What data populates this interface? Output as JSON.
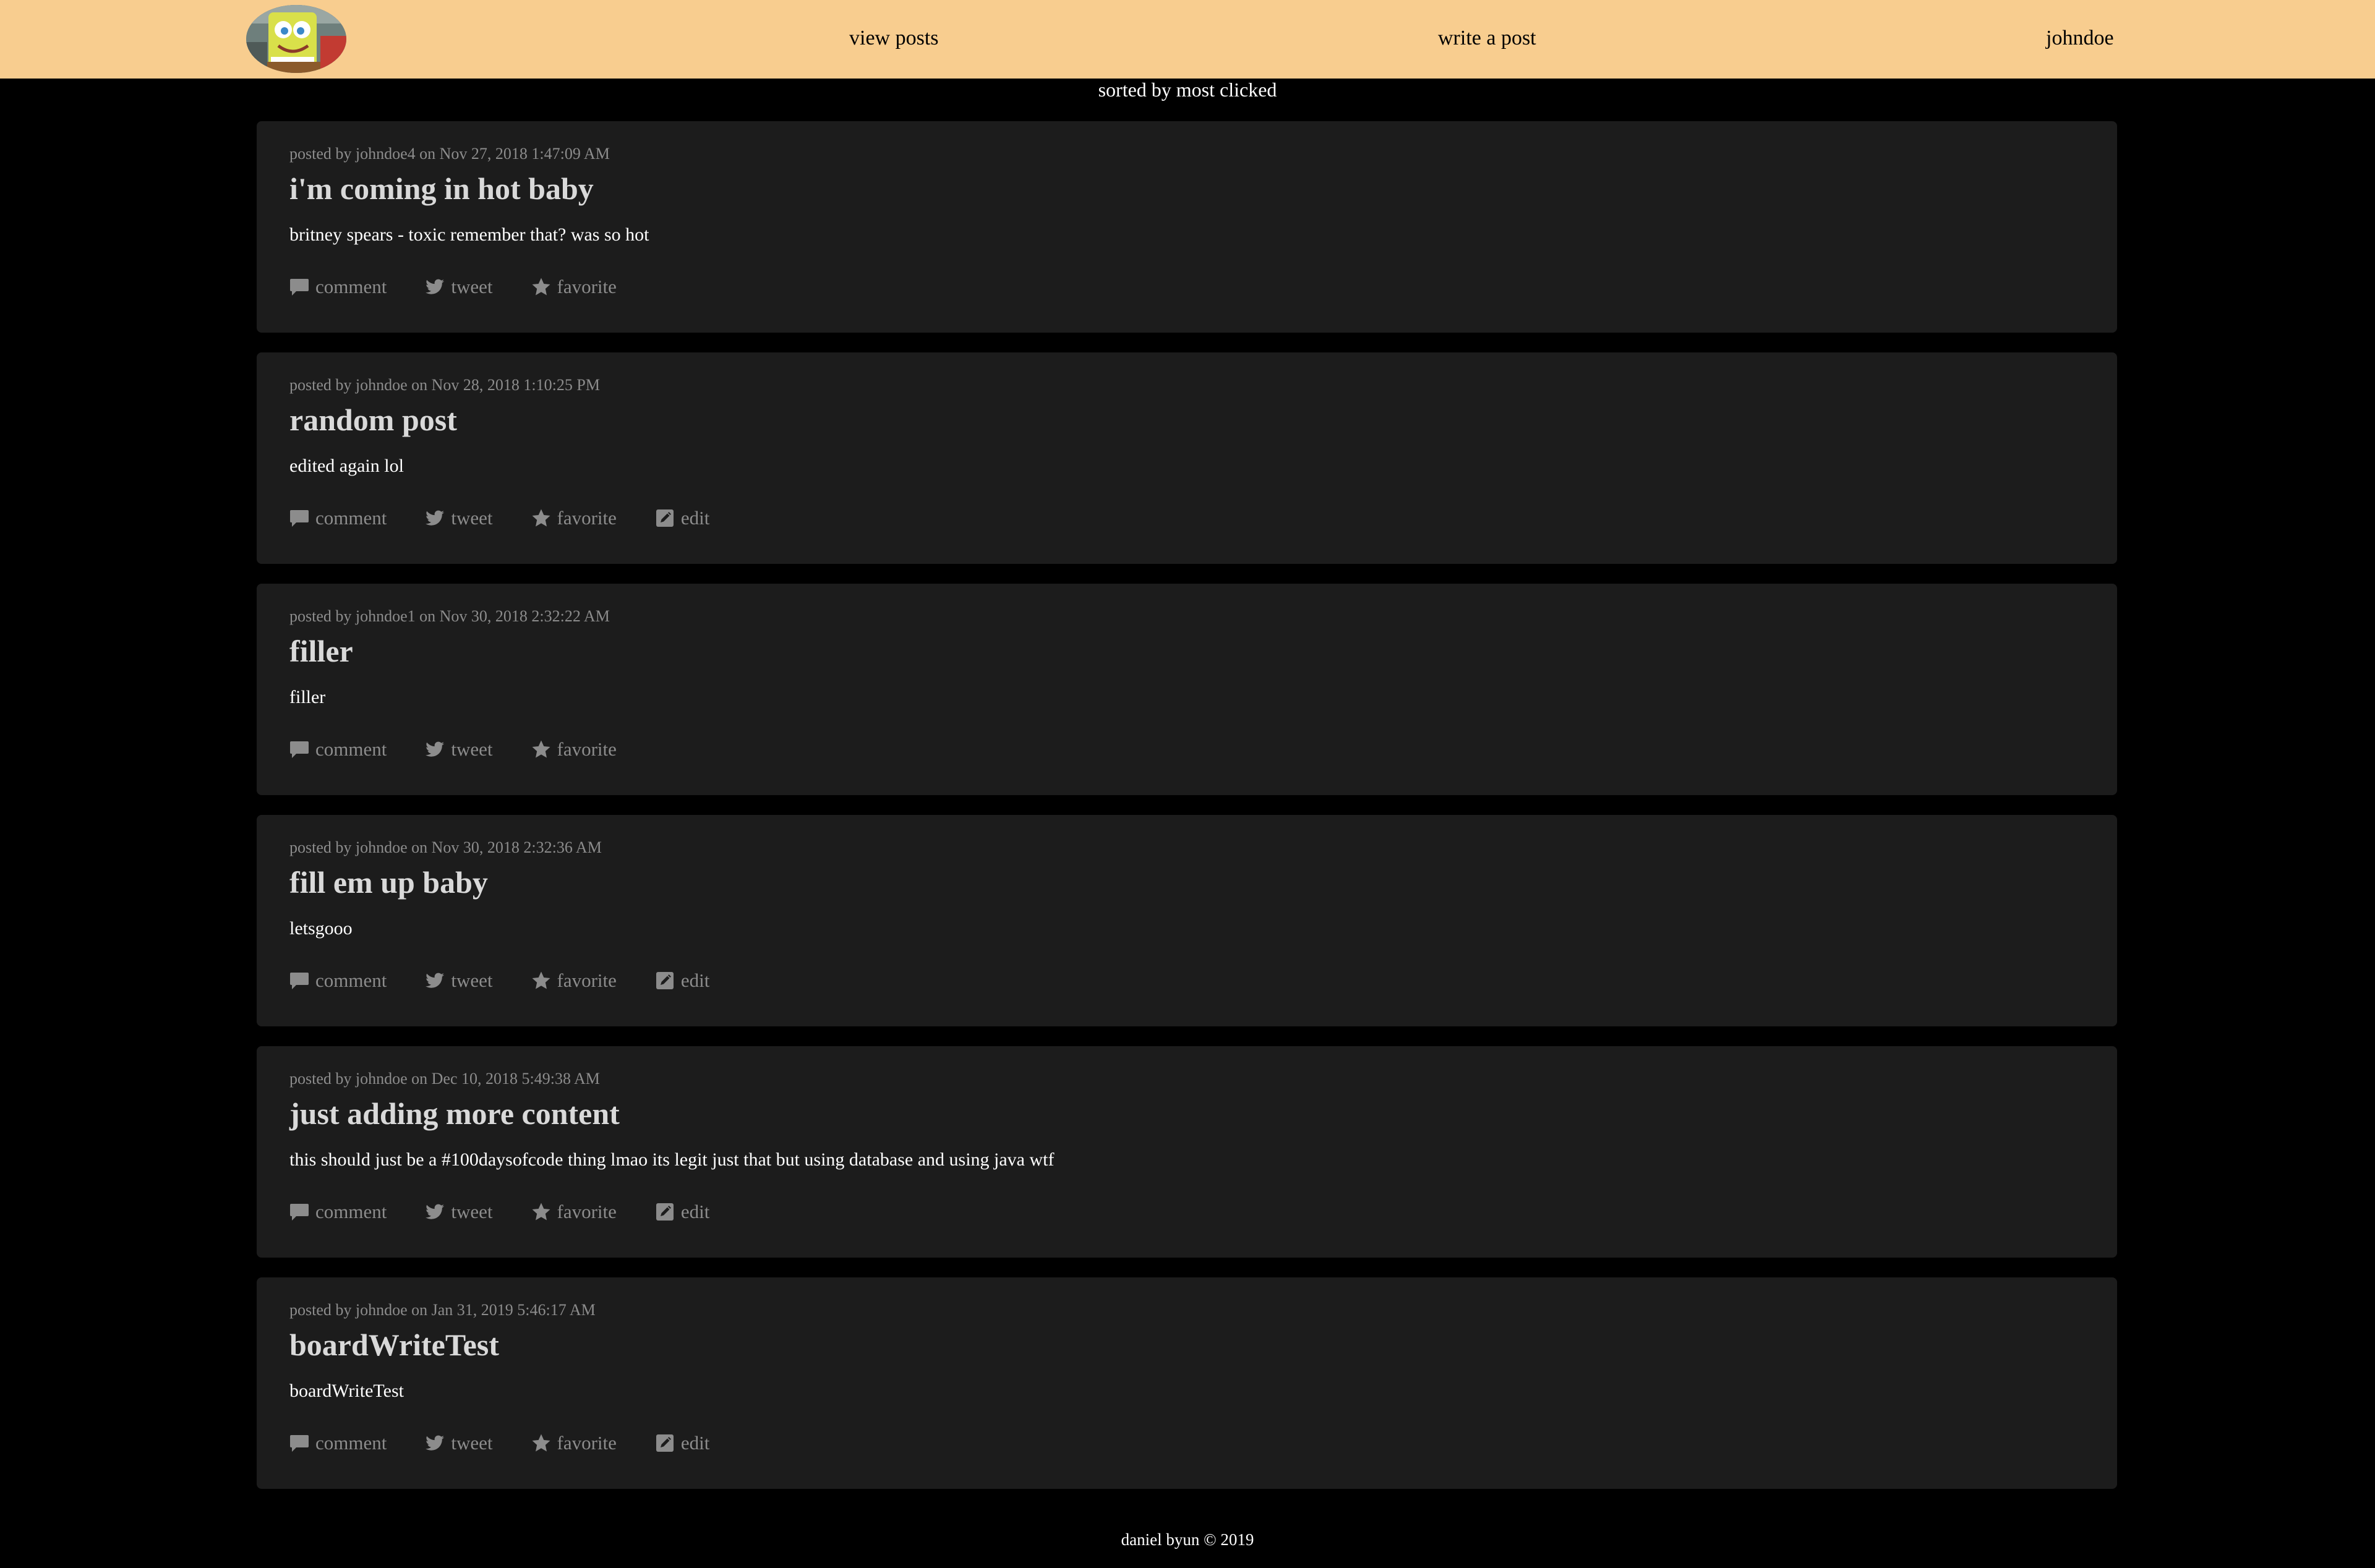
{
  "header": {
    "nav_view_posts": "view posts",
    "nav_write_post": "write a post",
    "nav_username": "johndoe"
  },
  "sort_label": "sorted by most clicked",
  "actions": {
    "comment": "comment",
    "tweet": "tweet",
    "favorite": "favorite",
    "edit": "edit"
  },
  "posts": [
    {
      "meta": "posted by johndoe4 on Nov 27, 2018 1:47:09 AM",
      "title": "i'm coming in hot baby",
      "body": "britney spears - toxic remember that? was so hot",
      "editable": false
    },
    {
      "meta": "posted by johndoe on Nov 28, 2018 1:10:25 PM",
      "title": "random post",
      "body": "edited again lol",
      "editable": true
    },
    {
      "meta": "posted by johndoe1 on Nov 30, 2018 2:32:22 AM",
      "title": "filler",
      "body": "filler",
      "editable": false
    },
    {
      "meta": "posted by johndoe on Nov 30, 2018 2:32:36 AM",
      "title": "fill em up baby",
      "body": "letsgooo",
      "editable": true
    },
    {
      "meta": "posted by johndoe on Dec 10, 2018 5:49:38 AM",
      "title": "just adding more content",
      "body": "this should just be a #100daysofcode thing lmao its legit just that but using database and using java wtf",
      "editable": true
    },
    {
      "meta": "posted by johndoe on Jan 31, 2019 5:46:17 AM",
      "title": "boardWriteTest",
      "body": "boardWriteTest",
      "editable": true
    }
  ],
  "footer": "daniel byun © 2019",
  "colors": {
    "navbar_bg": "#f8cd8f",
    "page_bg": "#000000",
    "card_bg": "#1c1c1c",
    "meta_text": "#8c8c8c",
    "title_text": "#d9d9d9"
  },
  "icons": {
    "logo": "spongebob-avatar-logo",
    "comment": "comment-icon",
    "tweet": "twitter-bird-icon",
    "favorite": "star-icon",
    "edit": "pencil-square-icon"
  }
}
